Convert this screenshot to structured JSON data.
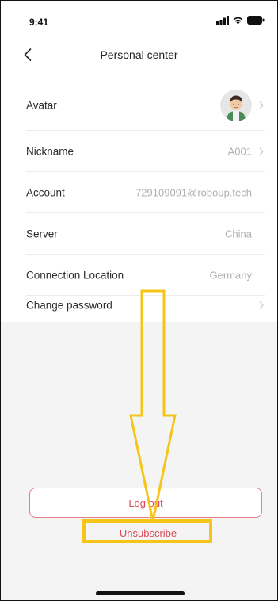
{
  "status_bar": {
    "time": "9:41"
  },
  "nav": {
    "title": "Personal center"
  },
  "rows": [
    {
      "label": "Avatar",
      "value": "",
      "has_avatar": true,
      "has_chevron": true
    },
    {
      "label": "Nickname",
      "value": "A001",
      "has_chevron": true
    },
    {
      "label": "Account",
      "value": "729109091@roboup.tech",
      "has_chevron": false
    },
    {
      "label": "Server",
      "value": "China",
      "has_chevron": false
    },
    {
      "label": "Connection Location",
      "value": "Germany",
      "has_chevron": false
    },
    {
      "label": "Change password",
      "value": "",
      "has_chevron": true
    }
  ],
  "actions": {
    "logout": "Log out",
    "unsubscribe": "Unsubscribe"
  },
  "colors": {
    "accent_red": "#d84a56",
    "annotation_yellow": "#f5c51a",
    "background": "#f4f4f4"
  },
  "icons": [
    "back-arrow-icon",
    "signal-icon",
    "wifi-icon",
    "battery-icon",
    "chevron-right-icon",
    "avatar-icon"
  ]
}
